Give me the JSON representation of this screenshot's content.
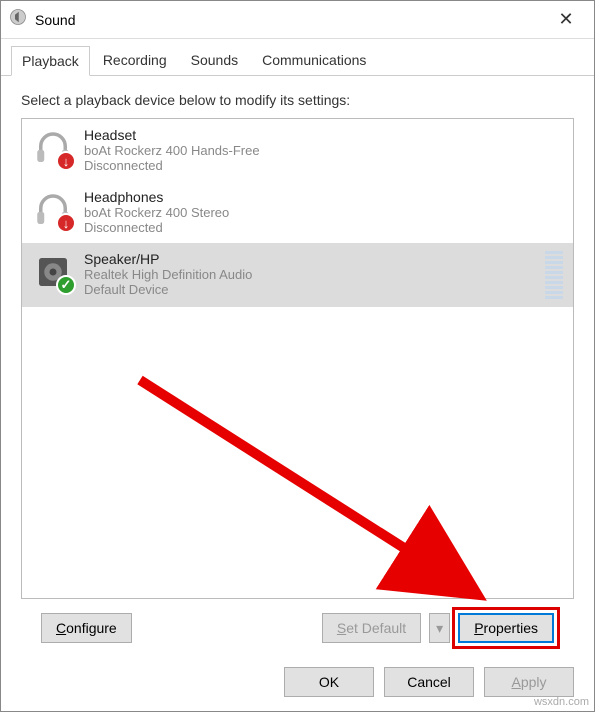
{
  "window": {
    "title": "Sound"
  },
  "tabs": [
    "Playback",
    "Recording",
    "Sounds",
    "Communications"
  ],
  "activeTab": 0,
  "prompt": "Select a playback device below to modify its settings:",
  "devices": [
    {
      "name": "Headset",
      "sub": "boAt Rockerz 400 Hands-Free",
      "status": "Disconnected",
      "icon": "headset",
      "badge": "down",
      "selected": false
    },
    {
      "name": "Headphones",
      "sub": "boAt Rockerz 400 Stereo",
      "status": "Disconnected",
      "icon": "headset",
      "badge": "down",
      "selected": false
    },
    {
      "name": "Speaker/HP",
      "sub": "Realtek High Definition Audio",
      "status": "Default Device",
      "icon": "speaker",
      "badge": "check",
      "selected": true
    }
  ],
  "buttons": {
    "configure": "Configure",
    "setDefault": "Set Default",
    "properties": "Properties",
    "ok": "OK",
    "cancel": "Cancel",
    "apply": "Apply"
  },
  "watermark": "wsxdn.com"
}
